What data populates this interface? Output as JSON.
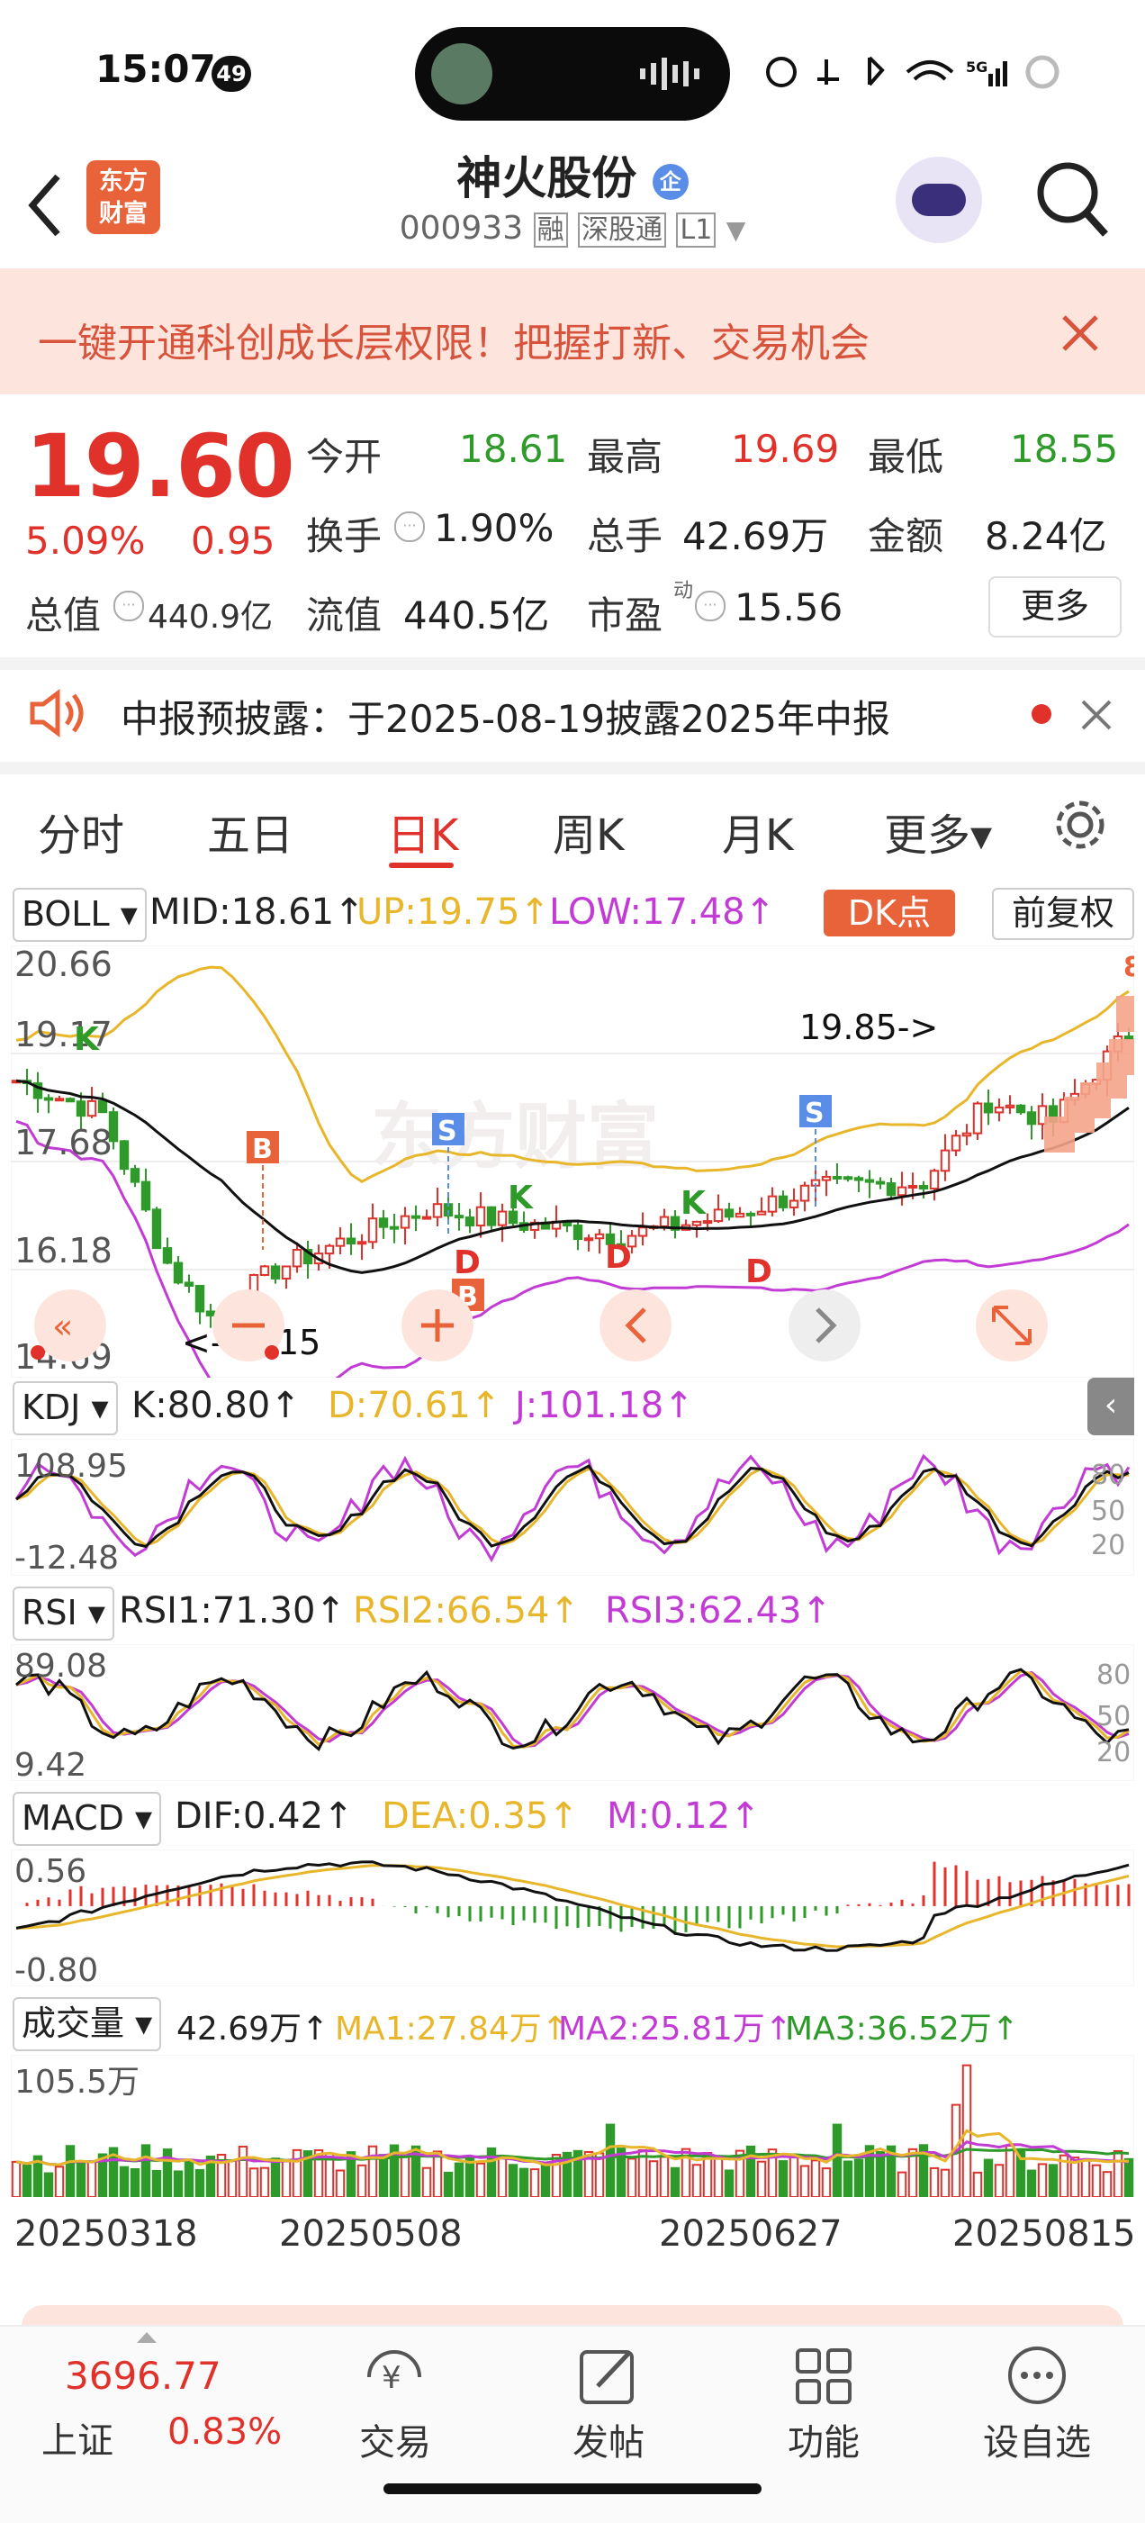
{
  "status_bar": {
    "time": "15:07",
    "badge": "49",
    "net": "5G"
  },
  "header": {
    "title": "神火股份",
    "title_badge": "企",
    "code": "000933",
    "tag1": "融",
    "tag2": "深股通",
    "tag3": "L1",
    "logo_line1": "东方",
    "logo_line2": "财富"
  },
  "banner": {
    "text": "一键开通科创成长层权限！把握打新、交易机会"
  },
  "quote": {
    "price": "19.60",
    "pct": "5.09%",
    "change": "0.95",
    "open_label": "今开",
    "open": "18.61",
    "high_label": "最高",
    "high": "19.69",
    "low_label": "最低",
    "low": "18.55",
    "turnover_label": "换手",
    "turnover": "1.90%",
    "volume_label": "总手",
    "volume": "42.69万",
    "amount_label": "金额",
    "amount": "8.24亿",
    "mktcap_label": "总值",
    "mktcap": "440.9亿",
    "float_label": "流值",
    "float_cap": "440.5亿",
    "pe_label": "市盈",
    "pe_sup": "动",
    "pe": "15.56",
    "more": "更多"
  },
  "notice": {
    "text": "中报预披露：于2025-08-19披露2025年中报"
  },
  "tabs": [
    {
      "label": "分时"
    },
    {
      "label": "五日"
    },
    {
      "label": "日K"
    },
    {
      "label": "周K"
    },
    {
      "label": "月K"
    },
    {
      "label": "更多▾"
    }
  ],
  "boll": {
    "name": "BOLL",
    "mid": "MID:18.61↑",
    "up": "UP:19.75↑",
    "low": "LOW:17.48↑",
    "dk": "DK点",
    "adj": "前复权",
    "y_ticks": [
      "20.66",
      "19.17",
      "17.68",
      "16.18",
      "14.69"
    ],
    "hi_note": "19.85->",
    "lo_note": "<-15.15",
    "watermark": "东方财富"
  },
  "kdj": {
    "name": "KDJ",
    "k": "K:80.80↑",
    "d": "D:70.61↑",
    "j": "J:101.18↑",
    "y_top": "108.95",
    "y_bot": "-12.48",
    "r1": "80",
    "r2": "50",
    "r3": "20"
  },
  "rsi": {
    "name": "RSI",
    "r1": "RSI1:71.30↑",
    "r2": "RSI2:66.54↑",
    "r3": "RSI3:62.43↑",
    "y_top": "89.08",
    "y_bot": "9.42",
    "g1": "80",
    "g2": "50",
    "g3": "20"
  },
  "macd": {
    "name": "MACD",
    "dif": "DIF:0.42↑",
    "dea": "DEA:0.35↑",
    "m": "M:0.12↑",
    "y_top": "0.56",
    "y_bot": "-0.80"
  },
  "vol": {
    "name": "成交量",
    "v": "42.69万↑",
    "ma1": "MA1:27.84万↑",
    "ma2": "MA2:25.81万↑",
    "ma3": "MA3:36.52万↑",
    "y_top": "105.5万"
  },
  "x_dates": [
    "20250318",
    "20250508",
    "20250627",
    "20250815"
  ],
  "bottom": {
    "index_value": "3696.77",
    "index_name": "上证",
    "index_pct": "0.83%",
    "nav": [
      {
        "label": "交易"
      },
      {
        "label": "发帖"
      },
      {
        "label": "功能"
      },
      {
        "label": "设自选"
      }
    ]
  },
  "colors": {
    "red": "#e0312b",
    "green": "#2e9a2a",
    "yellow": "#e8b62a",
    "magenta": "#c23bd4",
    "black": "#111111"
  }
}
